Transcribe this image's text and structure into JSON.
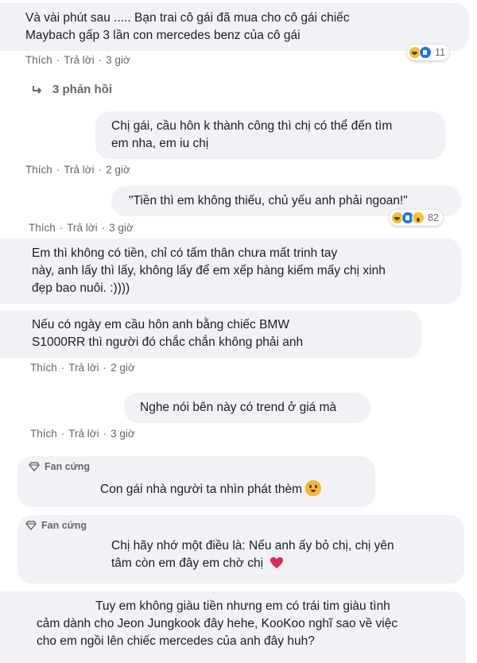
{
  "comments": [
    {
      "lines": [
        "Và vài phút sau ..... Bạn trai cô gái đã mua cho cô gái chiếc",
        "Maybach gấp 3 lần con mercedes benz của cô gái"
      ],
      "actions": {
        "like": "Thích",
        "reply": "Trả lời",
        "time": "3 giờ"
      },
      "reactions": {
        "types": [
          "haha-icon",
          "like-icon"
        ],
        "count": "11"
      }
    },
    {
      "lines": [
        "Chị gái, cầu hôn k thành công thì chị có thể đến tìm",
        "em nha, em iu chị"
      ],
      "actions": {
        "like": "Thích",
        "reply": "Trả lời",
        "time": "2 giờ"
      }
    },
    {
      "lines": [
        "\"Tiền thì em không thiếu, chủ yếu anh phải ngoan!\""
      ],
      "actions": {
        "like": "Thích",
        "reply": "Trả lời",
        "time": "3 giờ"
      },
      "reactions": {
        "types": [
          "haha-icon",
          "like-icon",
          "wow-icon"
        ],
        "count": "82"
      }
    },
    {
      "lines": [
        "Em thì không có tiền, chỉ có tấm thân chưa mất trinh tay",
        "này, anh lấy thì lấy, không lấy để em xếp hàng kiếm mấy chị xinh",
        "đẹp bao nuôi. :))))"
      ]
    },
    {
      "lines": [
        "Nếu có ngày em cầu hôn anh bằng chiếc BMW",
        "S1000RR thì người đó chắc chắn không phải anh"
      ],
      "actions": {
        "like": "Thích",
        "reply": "Trả lời",
        "time": "2 giờ"
      }
    },
    {
      "lines": [
        "Nghe nói bên này có trend ở giá mà"
      ],
      "actions": {
        "like": "Thích",
        "reply": "Trả lời",
        "time": "3 giờ"
      }
    },
    {
      "badge": "Fan cứng",
      "lines": [
        "Con gái nhà người ta nhìn phát thèm"
      ],
      "emoji": "crying-cat-icon"
    },
    {
      "badge": "Fan cứng",
      "lines": [
        "Chị hãy nhớ một điều là: Nếu anh ấy bỏ chị, chị yên",
        "tâm còn em đây em chờ chị"
      ],
      "emoji": "red-heart-icon"
    },
    {
      "lines": [
        "Tuy em không giàu tiền nhưng em có trái tim giàu tình",
        "cảm dành cho Jeon Jungkook đây hehe, KooKoo nghĩ sao về việc",
        "cho em ngồi lên chiếc mercedes của anh đây huh?"
      ]
    }
  ],
  "replies_toggle": "3 phản hồi",
  "separator": "·",
  "colors": {
    "bubble": "#f0f2f5",
    "meta": "#65676b",
    "heart": "#e0245e",
    "like_blue": "#1877f2"
  }
}
